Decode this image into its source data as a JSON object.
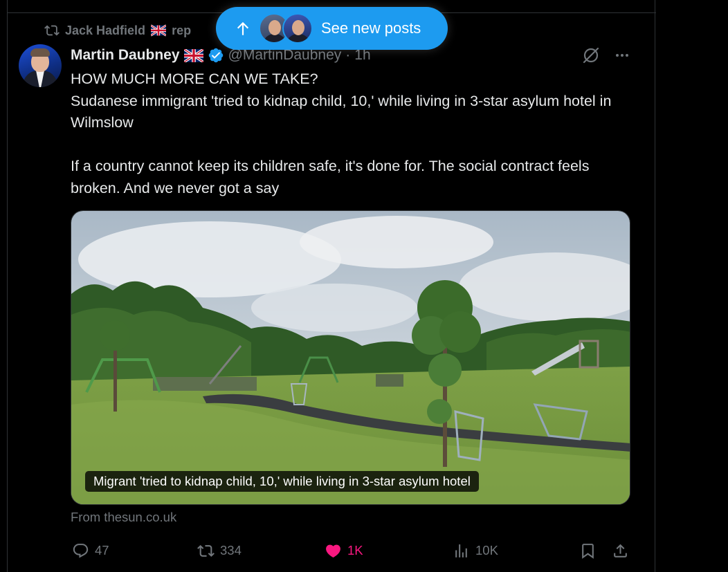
{
  "repost": {
    "text": "Jack Hadfield",
    "suffix": "rep"
  },
  "pill": {
    "label": "See new posts"
  },
  "post": {
    "display_name": "Martin Daubney",
    "handle": "@MartinDaubney",
    "dot": "·",
    "time": "1h",
    "text": "HOW MUCH MORE CAN WE TAKE?\nSudanese immigrant 'tried to kidnap child, 10,' while living in 3-star asylum hotel in Wilmslow\n\nIf a country cannot keep its children safe, it's done for. The social contract feels broken. And we never got a say"
  },
  "card": {
    "caption": "Migrant 'tried to kidnap child, 10,' while living in 3-star asylum hotel",
    "source": "From thesun.co.uk"
  },
  "actions": {
    "replies": "47",
    "reposts": "334",
    "likes": "1K",
    "views": "10K"
  },
  "colors": {
    "accent": "#1d9bf0",
    "like": "#f91880",
    "muted": "#71767b",
    "text": "#e7e9ea",
    "background": "#000000"
  }
}
